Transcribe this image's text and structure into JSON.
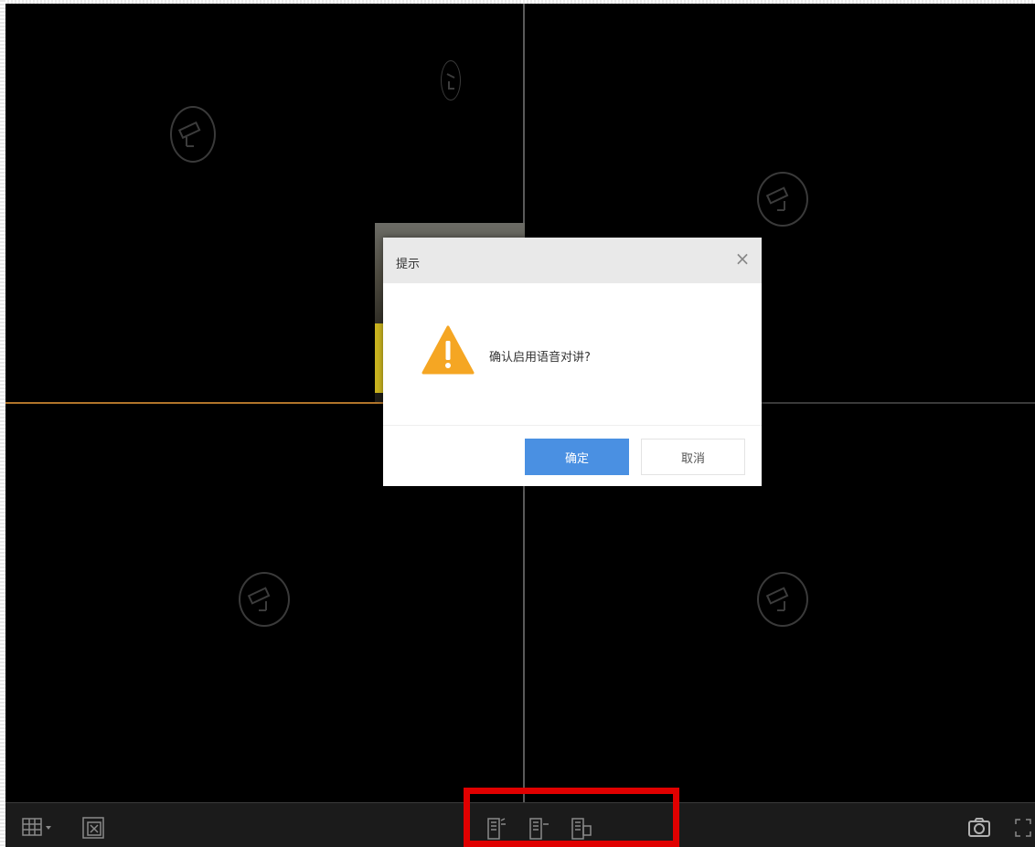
{
  "dialog": {
    "title": "提示",
    "message": "确认启用语音对讲?",
    "ok_label": "确定",
    "cancel_label": "取消",
    "close_glyph": "×"
  },
  "video_grid": {
    "layout": "2x2",
    "panes": [
      {
        "id": 1,
        "state": "selected"
      },
      {
        "id": 2,
        "state": "no-signal"
      },
      {
        "id": 3,
        "state": "no-signal"
      },
      {
        "id": 4,
        "state": "no-signal"
      }
    ]
  },
  "toolbar": {
    "left_icons": [
      "grid-layout-icon",
      "close-all-icon"
    ],
    "center_icons": [
      "intercom-start-icon",
      "intercom-talk-icon",
      "intercom-stop-icon"
    ],
    "right_icons": [
      "snapshot-icon",
      "fullscreen-icon"
    ]
  },
  "colors": {
    "background": "#000000",
    "dialog_header": "#e9e9e9",
    "primary_button": "#4a90e2",
    "warning": "#f5a623",
    "selected_border": "#b0742a",
    "highlight": "#e00000"
  }
}
